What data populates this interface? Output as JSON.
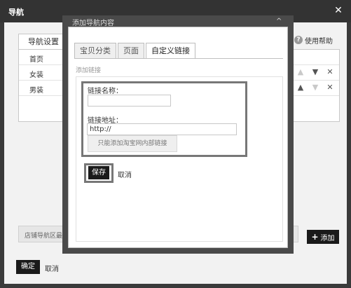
{
  "outer": {
    "title": "导航",
    "close_glyph": "✕",
    "tab_label": "导航设置",
    "help_label": "使用帮助",
    "help_icon_glyph": "?",
    "rows": [
      {
        "label": "首页"
      },
      {
        "label": "女装"
      },
      {
        "label": "男装"
      }
    ],
    "footer_text": "店铺导航区最多",
    "add_label": "添加",
    "add_icon_glyph": "+",
    "confirm_label": "确定",
    "cancel_label": "取消"
  },
  "dialog": {
    "title": "添加导航内容",
    "close_glyph": "^",
    "tabs": [
      {
        "label": "宝贝分类",
        "active": false
      },
      {
        "label": "页面",
        "active": false
      },
      {
        "label": "自定义链接",
        "active": true
      }
    ],
    "section_label": "添加链接",
    "name_label": "链接名称：",
    "name_value": "",
    "url_label": "链接地址：",
    "url_value": "http://",
    "hint": "只能添加淘宝网内部链接",
    "save_label": "保存",
    "cancel_label": "取消"
  },
  "icons": {
    "up": "arrow-up-icon",
    "down": "arrow-down-icon",
    "delete": "close-icon"
  },
  "colors": {
    "dark_button": "#1a1a1a",
    "frame": "#3a3a3a",
    "highlight_border": "#777777"
  }
}
